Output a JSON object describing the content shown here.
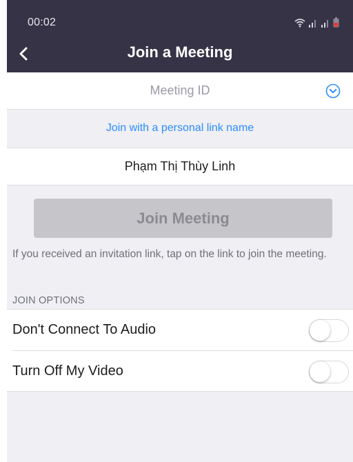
{
  "status_bar": {
    "time": "00:02",
    "icons": [
      "wifi-icon",
      "signal-icon",
      "signal-icon",
      "battery-icon"
    ],
    "battery_color": "#e53935"
  },
  "header": {
    "title": "Join a Meeting",
    "back_icon": "chevron-left-icon",
    "background": "#363346"
  },
  "meeting_id": {
    "placeholder": "Meeting ID",
    "value": "",
    "dropdown_icon": "chevron-down-circle-icon"
  },
  "personal_link": {
    "label": "Join with a personal link name",
    "color": "#2d8cff"
  },
  "name": {
    "value": "Phạm Thị Thùy Linh"
  },
  "join_button": {
    "label": "Join Meeting",
    "enabled": false
  },
  "hint": "If you received an invitation link, tap on the link to join the meeting.",
  "join_options": {
    "label": "JOIN OPTIONS",
    "items": [
      {
        "label": "Don't Connect To Audio",
        "on": false
      },
      {
        "label": "Turn Off My Video",
        "on": false
      }
    ]
  }
}
